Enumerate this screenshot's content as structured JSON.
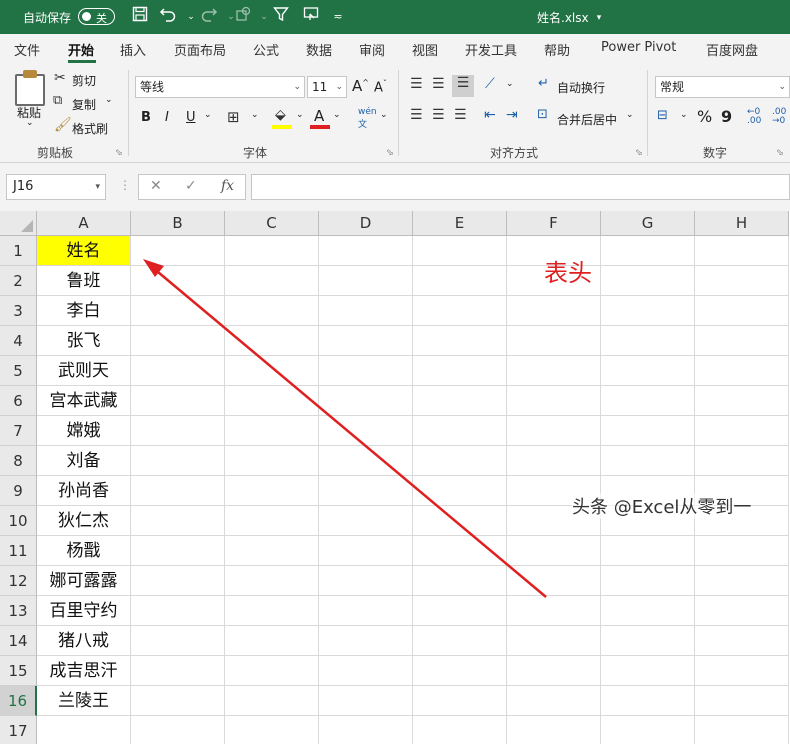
{
  "titlebar": {
    "autosave_label": "自动保存",
    "autosave_state": "关",
    "filename": "姓名.xlsx",
    "qat_icons": [
      "save-icon",
      "undo-icon",
      "redo-icon",
      "shapes-icon",
      "filter-icon",
      "touch-mode-icon",
      "customize-icon"
    ]
  },
  "tabs": [
    "文件",
    "开始",
    "插入",
    "页面布局",
    "公式",
    "数据",
    "审阅",
    "视图",
    "开发工具",
    "帮助",
    "Power Pivot",
    "百度网盘"
  ],
  "active_tab": "开始",
  "ribbon": {
    "clipboard": {
      "paste": "粘贴",
      "cut": "剪切",
      "copy": "复制",
      "format_painter": "格式刷",
      "label": "剪贴板"
    },
    "font": {
      "font_name": "等线",
      "font_size": "11",
      "bold": "B",
      "italic": "I",
      "underline": "U",
      "label": "字体",
      "fill_color": "#ffff00",
      "font_color": "#e02020"
    },
    "alignment": {
      "wrap_text": "自动换行",
      "merge_center": "合并后居中",
      "label": "对齐方式"
    },
    "number": {
      "format": "常规",
      "percent": "%",
      "comma": "9",
      "label": "数字"
    }
  },
  "formula_bar": {
    "name_box": "J16",
    "fx": "fx",
    "cancel": "✕",
    "enter": "✓",
    "value": ""
  },
  "columns": [
    "A",
    "B",
    "C",
    "D",
    "E",
    "F",
    "G",
    "H"
  ],
  "rows": [
    {
      "num": "1",
      "a": "姓名"
    },
    {
      "num": "2",
      "a": "鲁班"
    },
    {
      "num": "3",
      "a": "李白"
    },
    {
      "num": "4",
      "a": "张飞"
    },
    {
      "num": "5",
      "a": "武则天"
    },
    {
      "num": "6",
      "a": "宫本武藏"
    },
    {
      "num": "7",
      "a": "嫦娥"
    },
    {
      "num": "8",
      "a": "刘备"
    },
    {
      "num": "9",
      "a": "孙尚香"
    },
    {
      "num": "10",
      "a": "狄仁杰"
    },
    {
      "num": "11",
      "a": "杨戬"
    },
    {
      "num": "12",
      "a": "娜可露露"
    },
    {
      "num": "13",
      "a": "百里守约"
    },
    {
      "num": "14",
      "a": "猪八戒"
    },
    {
      "num": "15",
      "a": "成吉思汗"
    },
    {
      "num": "16",
      "a": "兰陵王"
    },
    {
      "num": "17",
      "a": ""
    }
  ],
  "selected_row": "16",
  "header_fill": "#ffff00",
  "accent": "#217346",
  "annotation": {
    "text": "表头",
    "color": "#e02020"
  },
  "watermark": "头条 @Excel从零到一"
}
